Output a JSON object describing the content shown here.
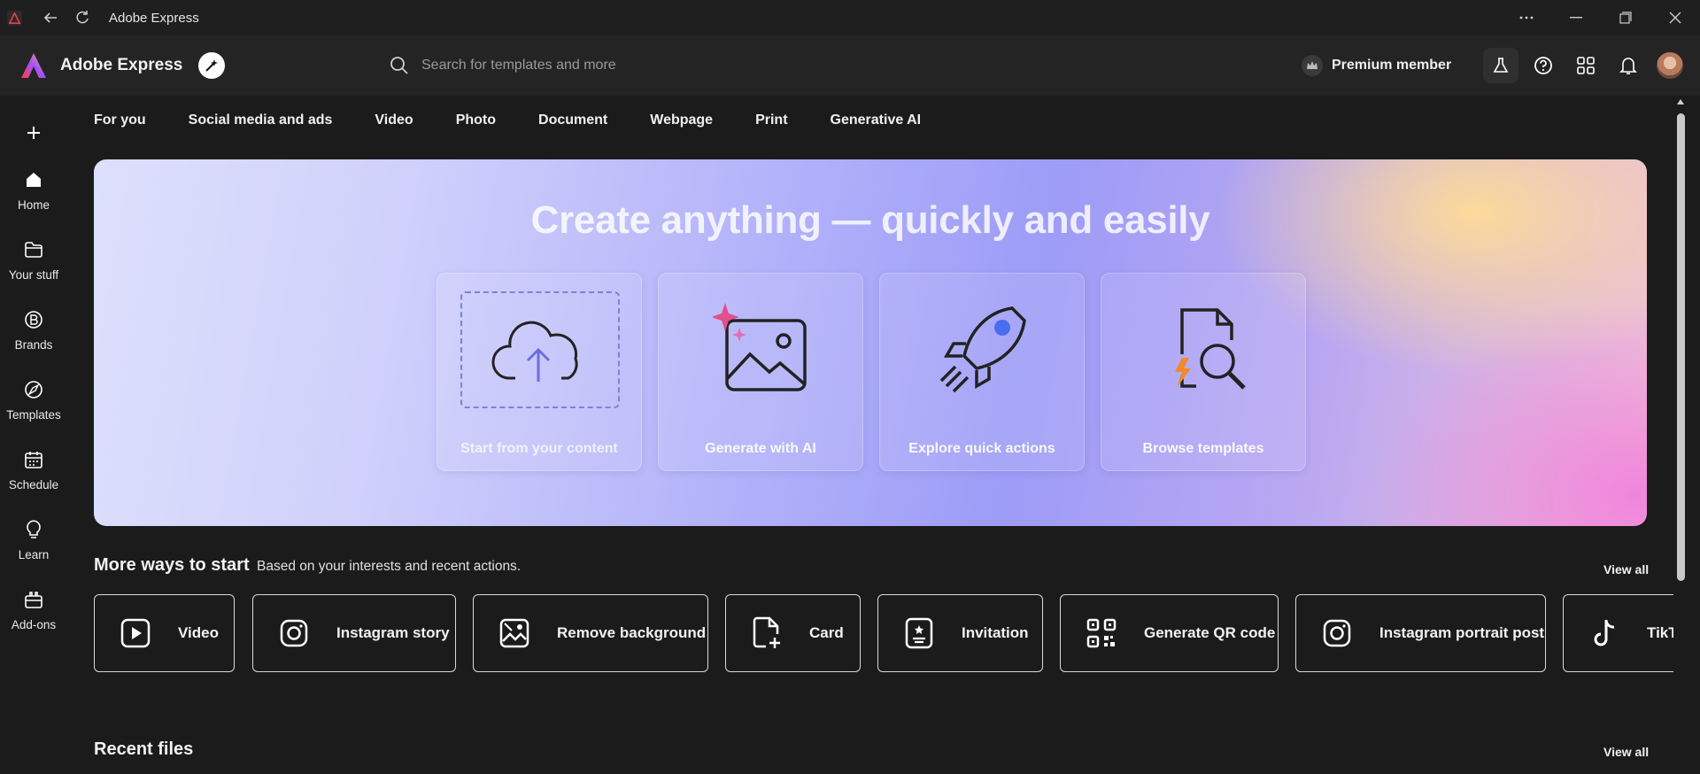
{
  "window": {
    "title": "Adobe Express"
  },
  "header": {
    "brand": "Adobe Express",
    "search_placeholder": "Search for templates and more",
    "premium_label": "Premium member"
  },
  "nav": {
    "create": "+",
    "items": [
      {
        "label": "Home",
        "icon": "home-icon"
      },
      {
        "label": "Your stuff",
        "icon": "folder-icon"
      },
      {
        "label": "Brands",
        "icon": "brand-icon"
      },
      {
        "label": "Templates",
        "icon": "templates-icon"
      },
      {
        "label": "Schedule",
        "icon": "calendar-icon"
      },
      {
        "label": "Learn",
        "icon": "lightbulb-icon"
      },
      {
        "label": "Add-ons",
        "icon": "addons-icon"
      }
    ]
  },
  "tabs": [
    "For you",
    "Social media and ads",
    "Video",
    "Photo",
    "Document",
    "Webpage",
    "Print",
    "Generative AI"
  ],
  "hero": {
    "title": "Create anything — quickly and easily",
    "cards": [
      {
        "label": "Start from your content",
        "icon": "cloud-upload-icon"
      },
      {
        "label": "Generate with AI",
        "icon": "image-sparkle-icon"
      },
      {
        "label": "Explore quick actions",
        "icon": "rocket-icon"
      },
      {
        "label": "Browse templates",
        "icon": "template-search-icon"
      }
    ]
  },
  "more_ways": {
    "title": "More ways to start",
    "subtitle": "Based on your interests and recent actions.",
    "view_all": "View all",
    "items": [
      {
        "label": "Video",
        "icon": "video-play-icon"
      },
      {
        "label": "Instagram story",
        "icon": "instagram-icon"
      },
      {
        "label": "Remove background",
        "icon": "remove-background-icon"
      },
      {
        "label": "Card",
        "icon": "card-add-icon"
      },
      {
        "label": "Invitation",
        "icon": "invitation-icon"
      },
      {
        "label": "Generate QR code",
        "icon": "qr-code-icon"
      },
      {
        "label": "Instagram portrait post",
        "icon": "instagram-icon"
      },
      {
        "label": "TikTok",
        "icon": "tiktok-icon"
      }
    ]
  },
  "recent": {
    "title": "Recent files",
    "view_all": "View all"
  },
  "colors": {
    "background": "#1b1b1b",
    "header": "#242424",
    "accent": "#7f7fe0"
  }
}
